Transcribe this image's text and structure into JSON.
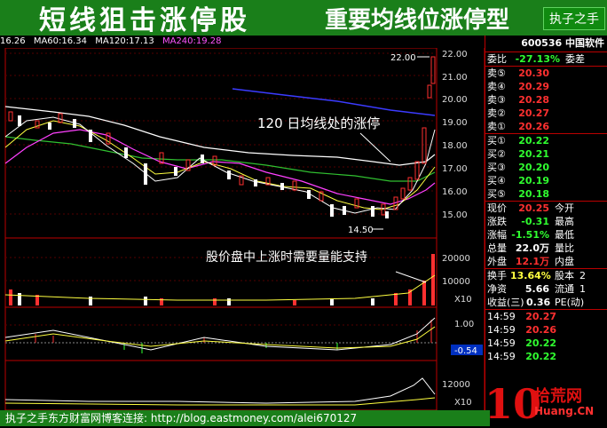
{
  "banner": {
    "left_title": "短线狙击涨停股",
    "right_title": "重要均线位涨停型",
    "badge": "执子之手"
  },
  "ma_bar": [
    {
      "label": "16.26",
      "color": "#ffffff"
    },
    {
      "label": "MA60:16.34",
      "color": "#ffffff"
    },
    {
      "label": "MA120:17.13",
      "color": "#ffffff"
    },
    {
      "label": "MA240:19.28",
      "color": "#ff55ff"
    }
  ],
  "annotations": {
    "ma120": "120 日均线处的涨停",
    "volume": "股价盘中上涨时需要量能支持",
    "high": "22.00",
    "low": "14.50"
  },
  "axis": {
    "price_ticks": [
      "22.00",
      "21.00",
      "20.00",
      "19.00",
      "18.00",
      "17.00",
      "16.00",
      "15.00"
    ],
    "vol_ticks": [
      "20000",
      "10000"
    ],
    "vol_unit": "X10",
    "macd_ticks": [
      "1.00",
      "-0.54"
    ],
    "bottom_ticks": [
      "12000",
      "X10"
    ]
  },
  "quote": {
    "code": "600536",
    "name": "中国软件",
    "weibi_label": "委比",
    "weibi": "-27.13%",
    "weicha_label": "委差",
    "asks": [
      {
        "label": "卖⑤",
        "price": "20.30"
      },
      {
        "label": "卖④",
        "price": "20.29"
      },
      {
        "label": "卖③",
        "price": "20.28"
      },
      {
        "label": "卖②",
        "price": "20.27"
      },
      {
        "label": "卖①",
        "price": "20.26"
      }
    ],
    "bids": [
      {
        "label": "买①",
        "price": "20.22"
      },
      {
        "label": "买②",
        "price": "20.21"
      },
      {
        "label": "买③",
        "price": "20.20"
      },
      {
        "label": "买④",
        "price": "20.19"
      },
      {
        "label": "买⑤",
        "price": "20.18"
      }
    ],
    "stats": [
      {
        "label": "现价",
        "value": "20.25",
        "extra": "今开",
        "color": "#ff3030"
      },
      {
        "label": "涨跌",
        "value": "-0.31",
        "extra": "最高",
        "color": "#30ff30"
      },
      {
        "label": "涨幅",
        "value": "-1.51%",
        "extra": "最低",
        "color": "#30ff30"
      },
      {
        "label": "总量",
        "value": "22.0万",
        "extra": "量比",
        "color": "#ffffff"
      },
      {
        "label": "外盘",
        "value": "12.1万",
        "extra": "内盘",
        "color": "#ff3030"
      }
    ],
    "stats2": [
      {
        "label": "换手",
        "value": "13.64%",
        "extra": "股本",
        "tail": "2"
      },
      {
        "label": "净资",
        "value": "5.66",
        "extra": "流通",
        "tail": "1"
      },
      {
        "label": "收益(三)",
        "value": "0.36",
        "extra": "PE(动)",
        "tail": ""
      }
    ],
    "ticks": [
      {
        "time": "14:59",
        "price": "20.27",
        "color": "#ff3030"
      },
      {
        "time": "14:59",
        "price": "20.26",
        "color": "#ff3030"
      },
      {
        "time": "14:59",
        "price": "20.22",
        "color": "#30ff30"
      },
      {
        "time": "14:59",
        "price": "20.22",
        "color": "#30ff30"
      }
    ]
  },
  "footer": "执子之手东方财富网博客连接: http://blog.eastmoney.com/alei670127",
  "logo": {
    "num": "10",
    "cn": "拾荒网",
    "url": "Huang.CN"
  }
}
